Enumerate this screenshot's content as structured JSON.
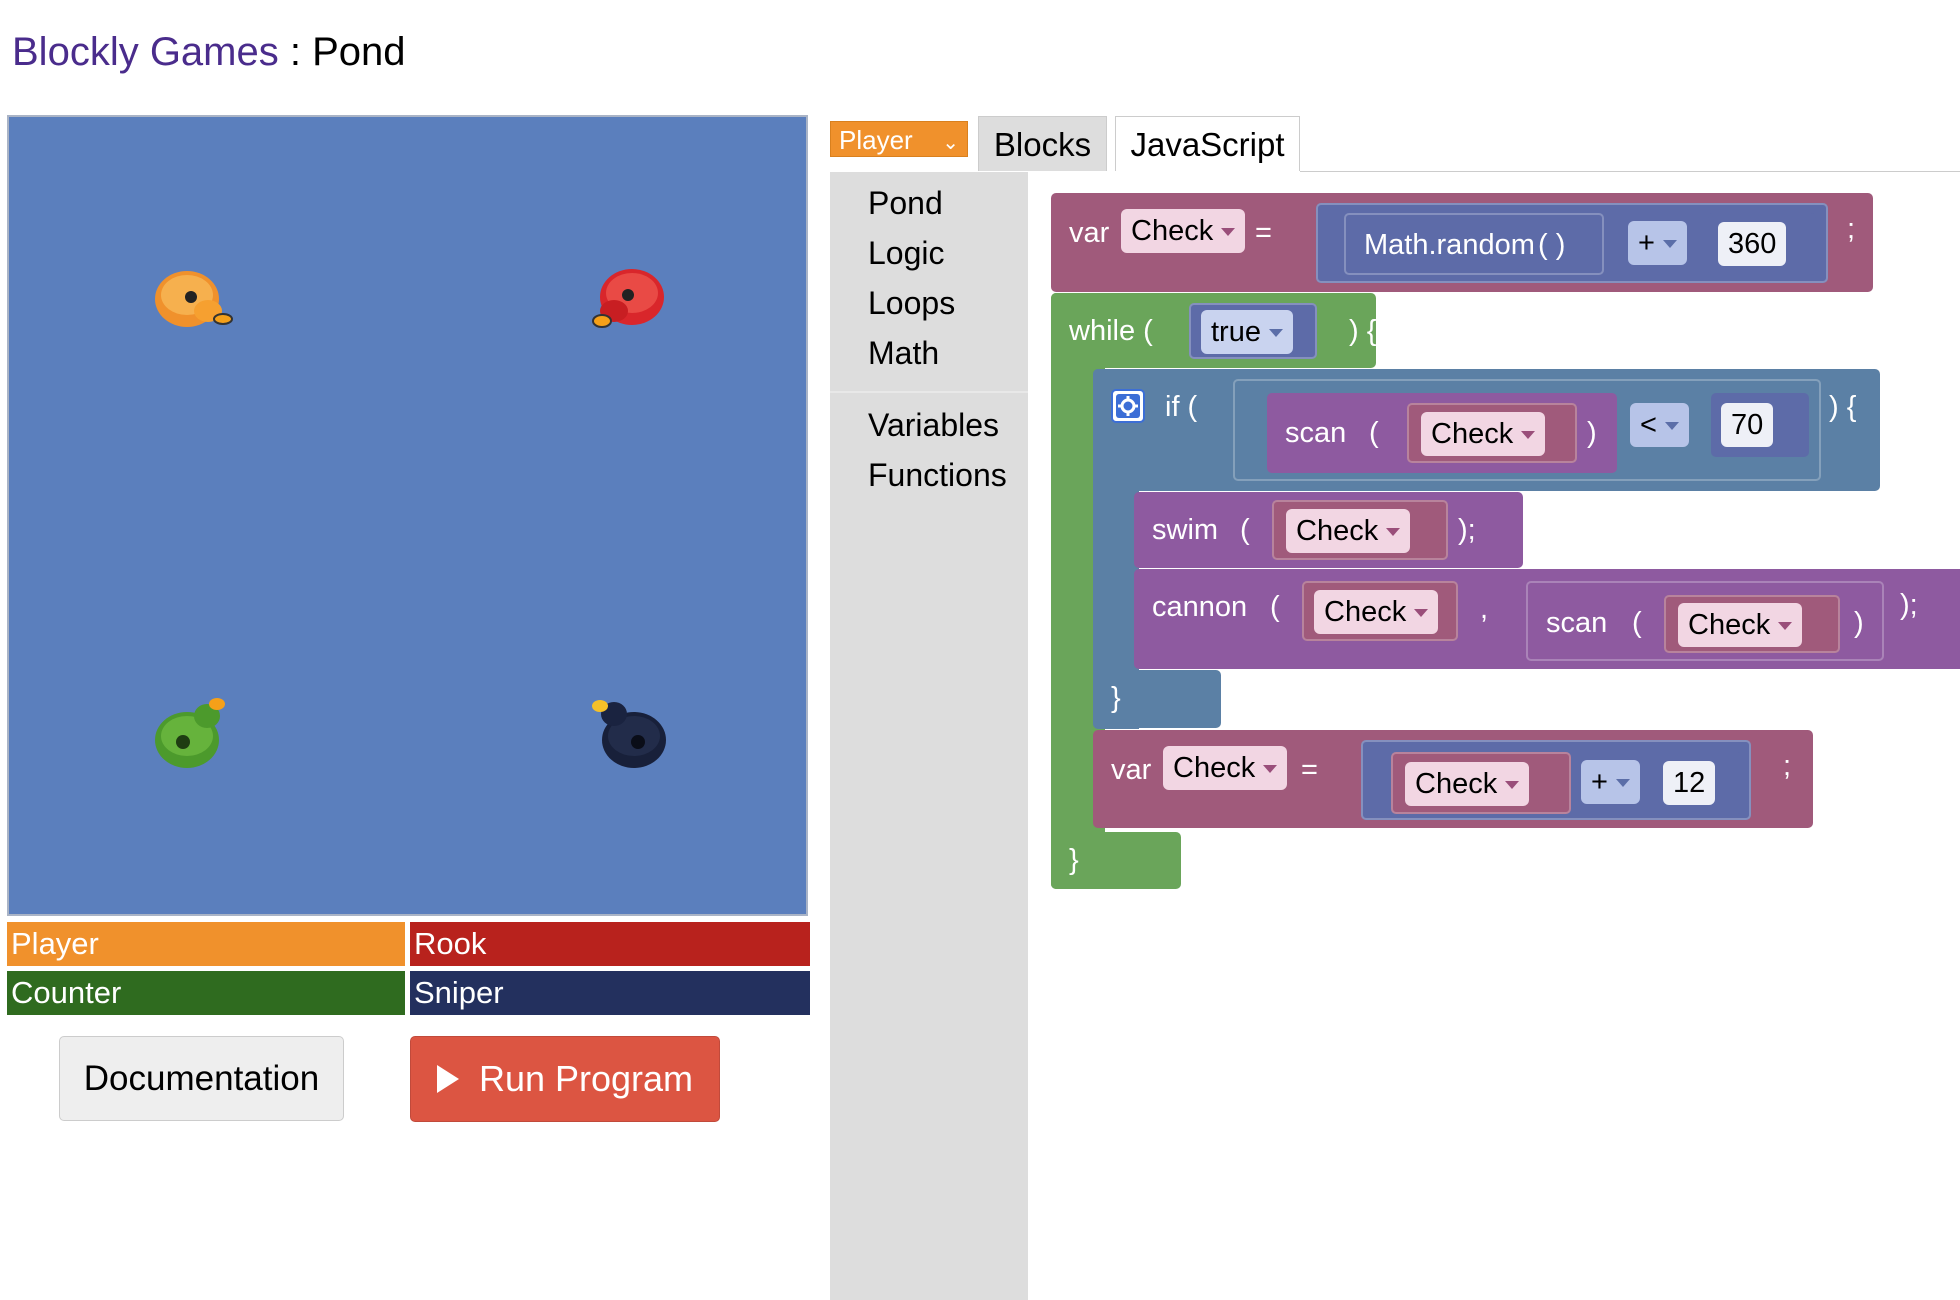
{
  "title": {
    "brand": "Blockly Games",
    "separator": " : ",
    "level": "Pond"
  },
  "players": [
    {
      "name": "Player",
      "color": "#f0912c"
    },
    {
      "name": "Rook",
      "color": "#b8221d"
    },
    {
      "name": "Counter",
      "color": "#2f6b1f"
    },
    {
      "name": "Sniper",
      "color": "#23305e"
    }
  ],
  "buttons": {
    "documentation": "Documentation",
    "run": "Run Program"
  },
  "editor": {
    "player_select": "Player",
    "tabs": {
      "blocks": "Blocks",
      "javascript": "JavaScript"
    },
    "toolbox": [
      "Pond",
      "Logic",
      "Loops",
      "Math",
      "Variables",
      "Functions"
    ]
  },
  "code": {
    "var1": {
      "kw": "var",
      "name": "Check",
      "eq": "=",
      "expr": "Math.random",
      "paren": "( )",
      "op": "+",
      "num": "360",
      "semi": ";"
    },
    "while": {
      "kw": "while (",
      "cond": "true",
      "close": ") {",
      "end": "}"
    },
    "if": {
      "kw": "if (",
      "fn": "scan",
      "lp": "(",
      "arg": "Check",
      "rp": ")",
      "op": "<",
      "num": "70",
      "close": ") {",
      "end": "}"
    },
    "swim": {
      "fn": "swim",
      "lp": "(",
      "arg": "Check",
      "end": ");"
    },
    "cannon": {
      "fn": "cannon",
      "lp": "(",
      "arg": "Check",
      "comma": ",",
      "fn2": "scan",
      "lp2": "(",
      "arg2": "Check",
      "rp2": ")",
      "end": ");"
    },
    "var2": {
      "kw": "var",
      "name": "Check",
      "eq": "=",
      "arg": "Check",
      "op": "+",
      "num": "12",
      "semi": ";"
    }
  }
}
